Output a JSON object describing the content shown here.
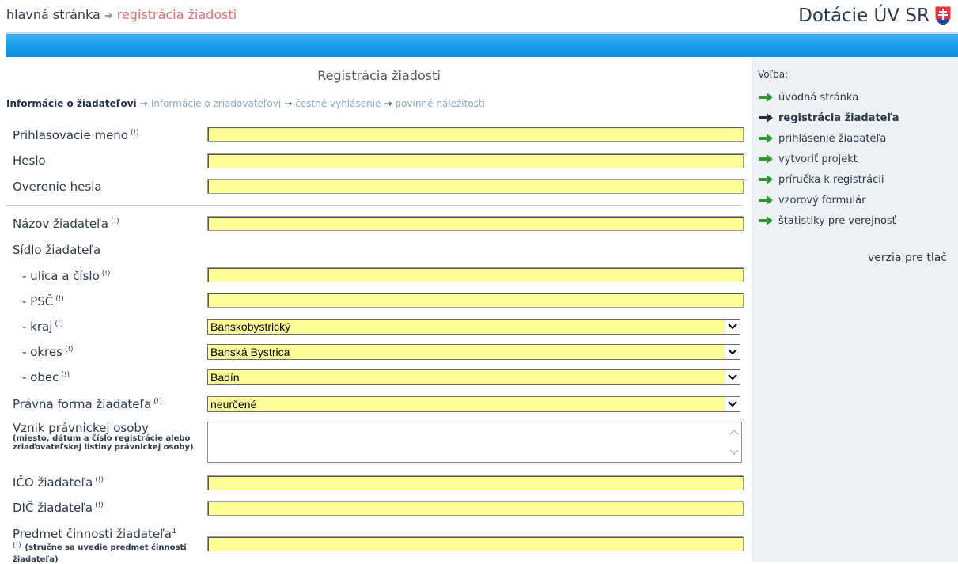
{
  "header": {
    "breadcrumb_home": "hlavná stránka",
    "breadcrumb_current": "registrácia žiadosti",
    "brand": "Dotácie ÚV SR"
  },
  "main": {
    "title": "Registrácia žiadosti",
    "steps": {
      "step1": "Informácie o žiadateľovi",
      "step2": "Informácie o zriaďovateľovi",
      "step3": "čestné vyhlásenie",
      "step4": "povinné náležitosti",
      "arrow": "→"
    },
    "required_marker": "(!)",
    "fields": {
      "login": "Prihlasovacie meno",
      "password": "Heslo",
      "password_confirm": "Overenie hesla",
      "name": "Názov žiadateľa",
      "seat": "Sídlo žiadateľa",
      "street": "- ulica a číslo",
      "psc": "- PSČ",
      "kraj": "- kraj",
      "okres": "- okres",
      "obec": "- obec",
      "legal_form": "Právna forma žiadateľa",
      "origin": "Vznik právnickej osoby",
      "origin_hint": "(miesto, dátum a číslo registrácie alebo zriaďovateľskej listiny právnickej osoby)",
      "ico": "IČO žiadateľa",
      "dic": "DIČ žiadateľa",
      "activity": "Predmet činnosti žiadateľa",
      "activity_sup": "1",
      "activity_hint": "(stručne sa uvedie predmet činnosti žiadateľa)"
    },
    "selects": {
      "kraj": "Banskobystrický",
      "okres": "Banská Bystrica",
      "obec": "Badín",
      "legal_form": "neurčené"
    }
  },
  "sidebar": {
    "title": "Voľba:",
    "items": [
      "úvodná stránka",
      "registrácia žiadateľa",
      "prihlásenie žiadateľa",
      "vytvoriť projekt",
      "príručka k registrácii",
      "vzorový formulár",
      "štatistiky pre verejnosť"
    ],
    "print": "verzia pre tlač"
  },
  "colors": {
    "input_bg": "#ffff99",
    "bar_blue": "#159ae9",
    "sidebar_bg": "#edf0f4",
    "accent_red": "#e07070",
    "arrow_green": "#2e9a2e"
  }
}
